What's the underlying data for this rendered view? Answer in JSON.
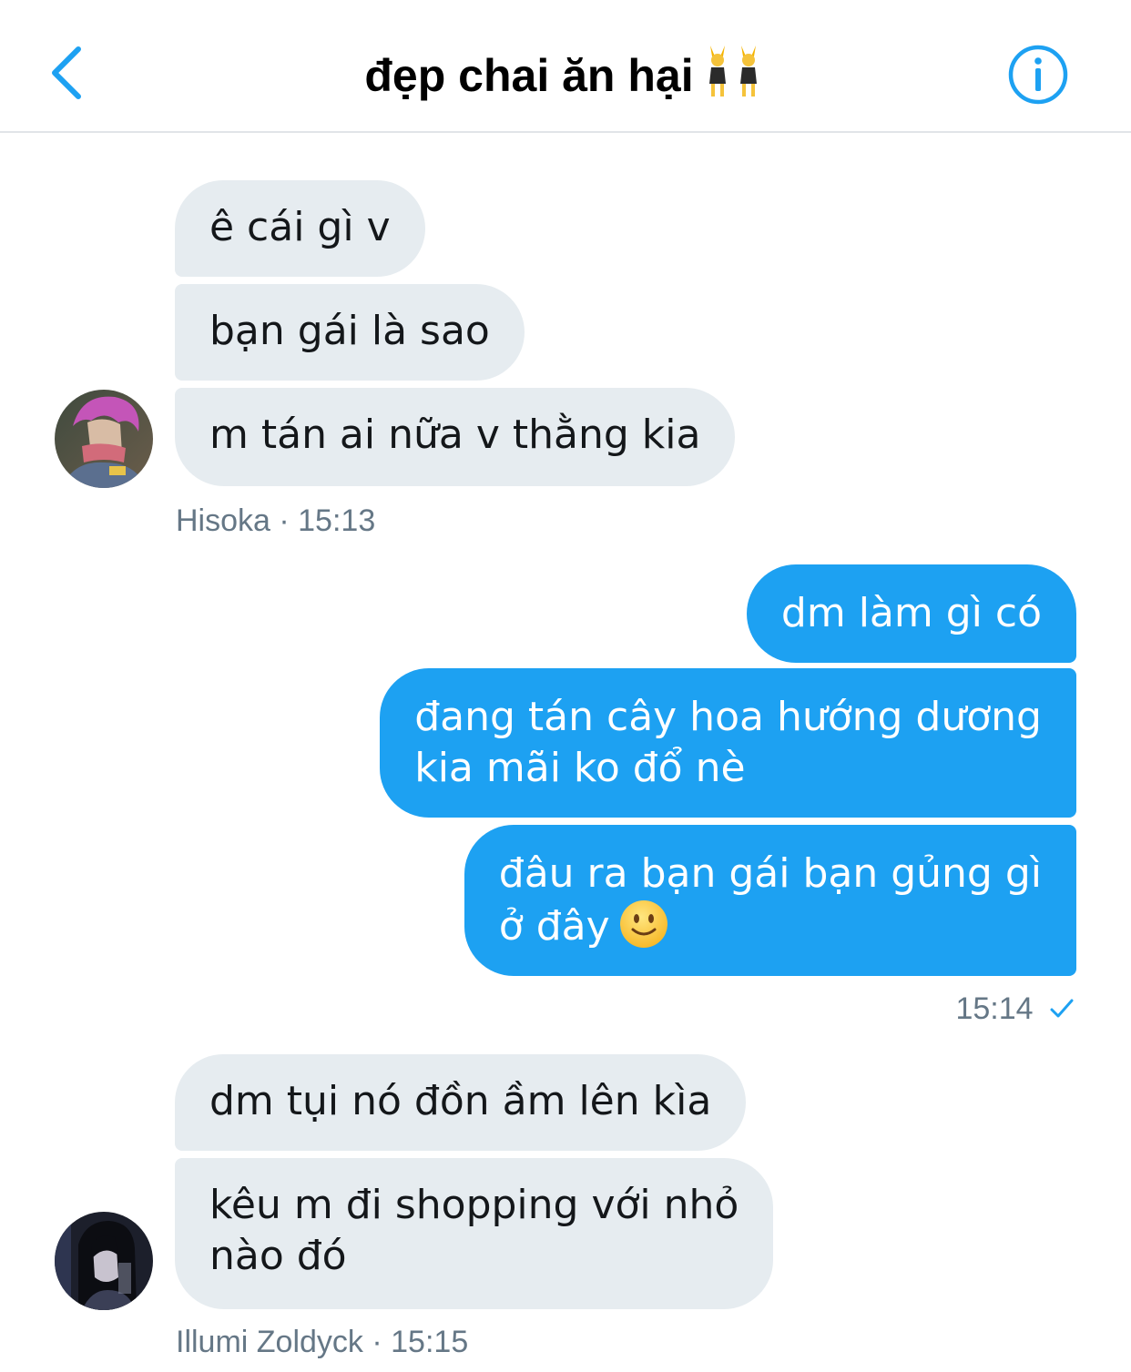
{
  "header": {
    "title": "đẹp chai ăn hại",
    "title_emoji": "people-with-bunny-ears-emoji",
    "back_icon": "chevron-left-icon",
    "info_icon": "info-circle-icon"
  },
  "colors": {
    "accent": "#1da1f2",
    "incoming_bubble": "#e6ecf0",
    "meta_text": "#657786"
  },
  "conversation": {
    "group1": {
      "sender": "Hisoka",
      "time": "15:13",
      "meta": "Hisoka · 15:13",
      "messages": [
        "ê cái gì v",
        "bạn gái là sao",
        "m tán ai nữa v thằng kia"
      ]
    },
    "group2": {
      "time": "15:14",
      "status_icon": "checkmark-icon",
      "messages": {
        "m1": "dm làm gì có",
        "m2_line1": "đang tán cây hoa hướng dương",
        "m2_line2": "kia mãi ko đổ nè",
        "m3_line1": "đâu ra bạn gái bạn gủng gì",
        "m3_line2": "ở đây",
        "m3_emoji": "slightly-smiling-face-emoji"
      }
    },
    "group3": {
      "sender": "Illumi Zoldyck",
      "time": "15:15",
      "meta": "Illumi Zoldyck · 15:15",
      "messages": {
        "m1": "dm tụi nó đồn ầm lên kìa",
        "m2_line1": "kêu m đi shopping với nhỏ",
        "m2_line2": "nào đó"
      }
    }
  }
}
